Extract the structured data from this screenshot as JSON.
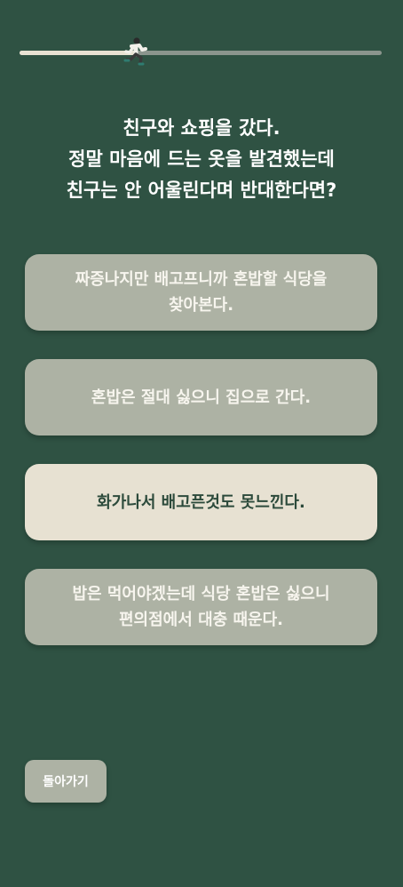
{
  "progress": {
    "fraction": 0.32,
    "runner_icon": "runner-icon"
  },
  "question": {
    "text": "친구와 쇼핑을 갔다.\n정말 마음에 드는 옷을 발견했는데\n친구는 안 어울린다며 반대한다면?"
  },
  "options": [
    {
      "label": "짜증나지만 배고프니까 혼밥할 식당을\n찾아본다.",
      "selected": false
    },
    {
      "label": "혼밥은 절대 싫으니 집으로 간다.",
      "selected": false
    },
    {
      "label": "화가나서 배고픈것도 못느낀다.",
      "selected": true
    },
    {
      "label": "밥은 먹어야겠는데 식당 혼밥은 싫으니\n편의점에서 대충 때운다.",
      "selected": false
    }
  ],
  "back_button": {
    "label": "돌아가기"
  },
  "colors": {
    "background": "#2f5243",
    "option": "#adb2a4",
    "option_selected": "#e7e1d2",
    "progress_track": "#8b958d",
    "progress_fill": "#e8e2d3"
  }
}
